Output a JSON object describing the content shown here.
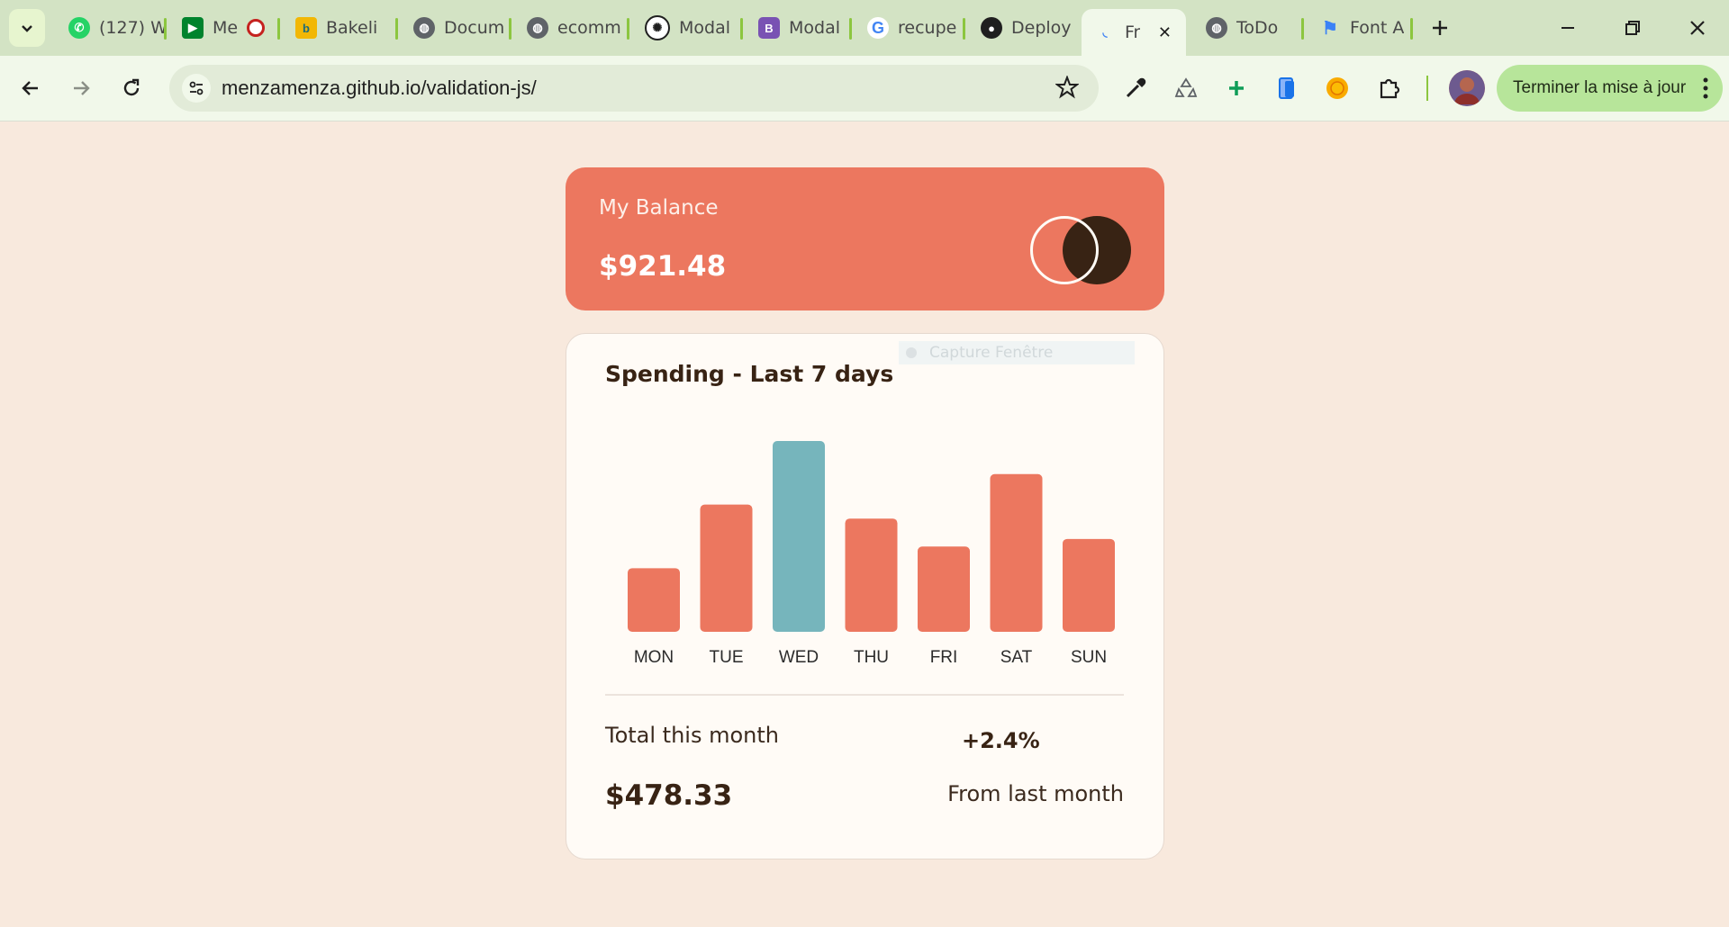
{
  "browser": {
    "tabs": [
      {
        "label": "(127) W",
        "icon": "whatsapp-icon"
      },
      {
        "label": "Me",
        "icon": "google-meet-icon"
      },
      {
        "label": "Bakeli",
        "icon": "bakeli-icon"
      },
      {
        "label": "Docum",
        "icon": "globe-icon"
      },
      {
        "label": "ecomm",
        "icon": "globe-icon"
      },
      {
        "label": "Modal",
        "icon": "openai-icon"
      },
      {
        "label": "Modal",
        "icon": "bootstrap-icon"
      },
      {
        "label": "recupe",
        "icon": "google-icon"
      },
      {
        "label": "Deploy",
        "icon": "github-icon"
      },
      {
        "label": "Fr",
        "icon": "loading-icon",
        "active": true
      },
      {
        "label": "ToDo",
        "icon": "globe-icon"
      },
      {
        "label": "Font A",
        "icon": "font-awesome-icon"
      }
    ],
    "url": "menzamenza.github.io/validation-js/",
    "update_button": "Terminer la mise à jour"
  },
  "balance": {
    "label": "My Balance",
    "value": "$921.48"
  },
  "spending": {
    "title": "Spending - Last 7 days",
    "overlay_text": "Capture Fenêtre",
    "total_label": "Total this month",
    "total_value": "$478.33",
    "change_value": "+2.4%",
    "change_label": "From last month"
  },
  "colors": {
    "bar": "#ec775f",
    "bar_highlight": "#76b5bc",
    "accent_dark": "#382314",
    "background": "#f8e9dd"
  },
  "chart_data": {
    "type": "bar",
    "categories": [
      "MON",
      "TUE",
      "WED",
      "THU",
      "FRI",
      "SAT",
      "SUN"
    ],
    "values": [
      17.45,
      34.91,
      52.36,
      31.07,
      23.39,
      43.28,
      25.48
    ],
    "highlight_index": 2,
    "title": "Spending - Last 7 days",
    "xlabel": "",
    "ylabel": "",
    "grid": false,
    "legend": "none"
  }
}
